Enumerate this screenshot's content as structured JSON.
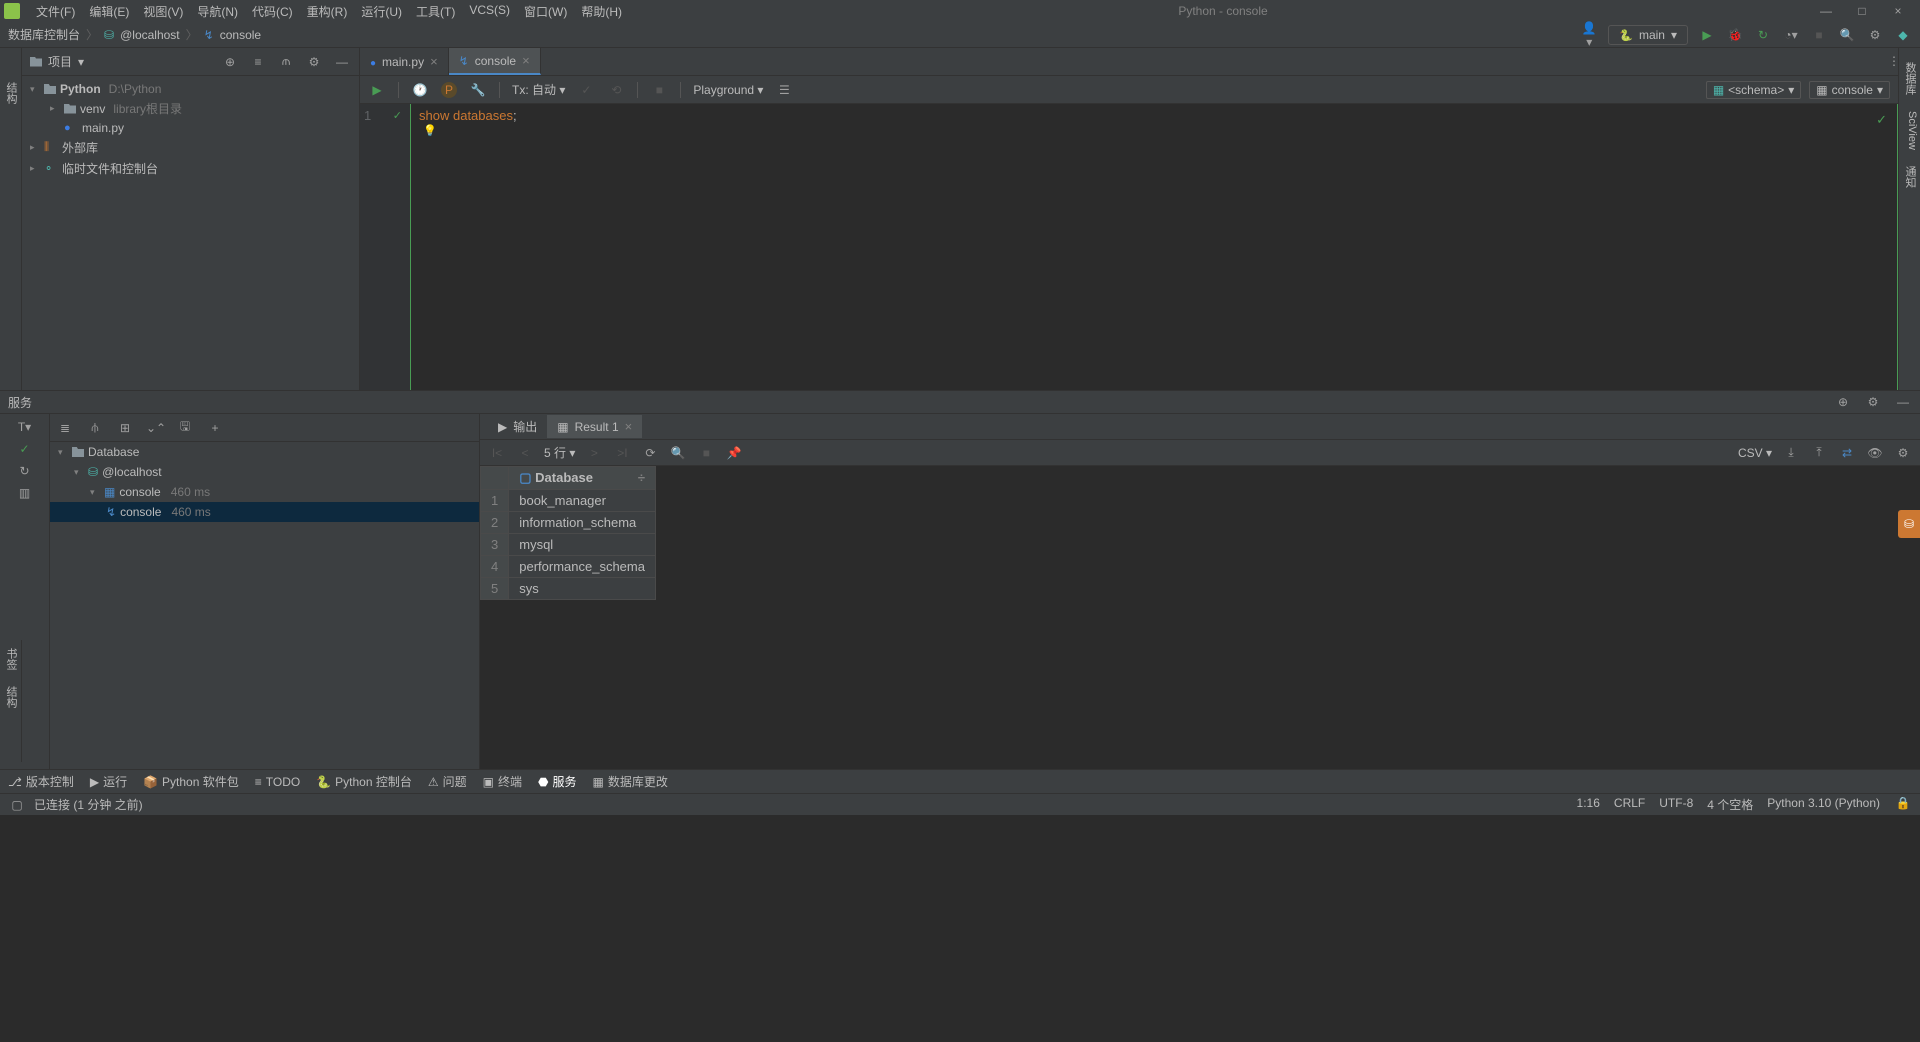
{
  "window": {
    "title": "Python - console",
    "minimize": "—",
    "maximize": "□",
    "close": "×"
  },
  "menu": [
    "文件(F)",
    "编辑(E)",
    "视图(V)",
    "导航(N)",
    "代码(C)",
    "重构(R)",
    "运行(U)",
    "工具(T)",
    "VCS(S)",
    "窗口(W)",
    "帮助(H)"
  ],
  "breadcrumbs": [
    "数据库控制台",
    "@localhost",
    "console"
  ],
  "run_config": "main",
  "project_panel": {
    "title": "项目",
    "tree": {
      "root": "Python",
      "root_hint": "D:\\Python",
      "venv": "venv",
      "venv_hint": "library根目录",
      "main_file": "main.py",
      "ext_libs": "外部库",
      "scratch": "临时文件和控制台"
    }
  },
  "left_gutter_tabs": [
    "结构",
    "书签"
  ],
  "right_gutter_tabs": [
    "数据库",
    "SciView",
    "通知"
  ],
  "editor": {
    "tabs": [
      {
        "label": "main.py",
        "active": false
      },
      {
        "label": "console",
        "active": true
      }
    ],
    "toolbar": {
      "tx": "Tx: 自动",
      "playground": "Playground",
      "schema": "<schema>",
      "console": "console"
    },
    "code": {
      "line_no": "1",
      "kw1": "show",
      "kw2": "databases",
      "semi": ";"
    }
  },
  "services": {
    "title": "服务",
    "tree": {
      "database": "Database",
      "localhost": "@localhost",
      "console_grp": "console",
      "console_grp_hint": "460 ms",
      "console_item": "console",
      "console_item_hint": "460 ms"
    },
    "result_tabs": {
      "output": "输出",
      "result": "Result 1"
    },
    "rows_label": "5 行",
    "csv": "CSV",
    "table": {
      "header": "Database",
      "rows": [
        "book_manager",
        "information_schema",
        "mysql",
        "performance_schema",
        "sys"
      ]
    }
  },
  "bottom_tools": [
    "版本控制",
    "运行",
    "Python 软件包",
    "TODO",
    "Python 控制台",
    "问题",
    "终端",
    "服务",
    "数据库更改"
  ],
  "status": {
    "left": "已连接 (1 分钟 之前)",
    "right": [
      "1:16",
      "CRLF",
      "UTF-8",
      "4 个空格",
      "Python 3.10 (Python)"
    ]
  }
}
